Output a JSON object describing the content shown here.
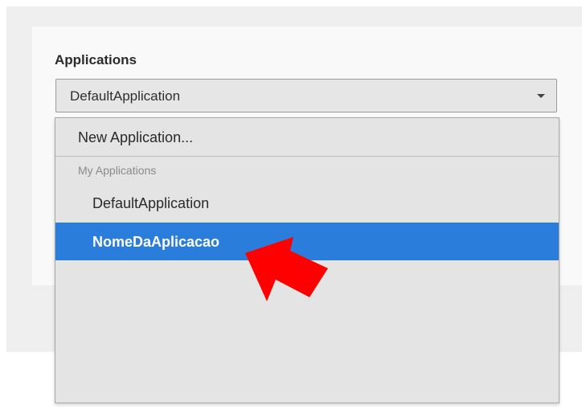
{
  "applications": {
    "label": "Applications",
    "selected": "DefaultApplication",
    "menu": {
      "new_item": "New Application...",
      "group_label": "My Applications",
      "items": [
        {
          "label": "DefaultApplication",
          "highlighted": false
        },
        {
          "label": "NomeDaAplicacao",
          "highlighted": true
        }
      ]
    }
  },
  "colors": {
    "highlight": "#2a7ddb",
    "arrow": "#ff0000"
  },
  "icons": {
    "caret": "chevron-down-icon",
    "pointer": "red-arrow-annotation-icon"
  }
}
